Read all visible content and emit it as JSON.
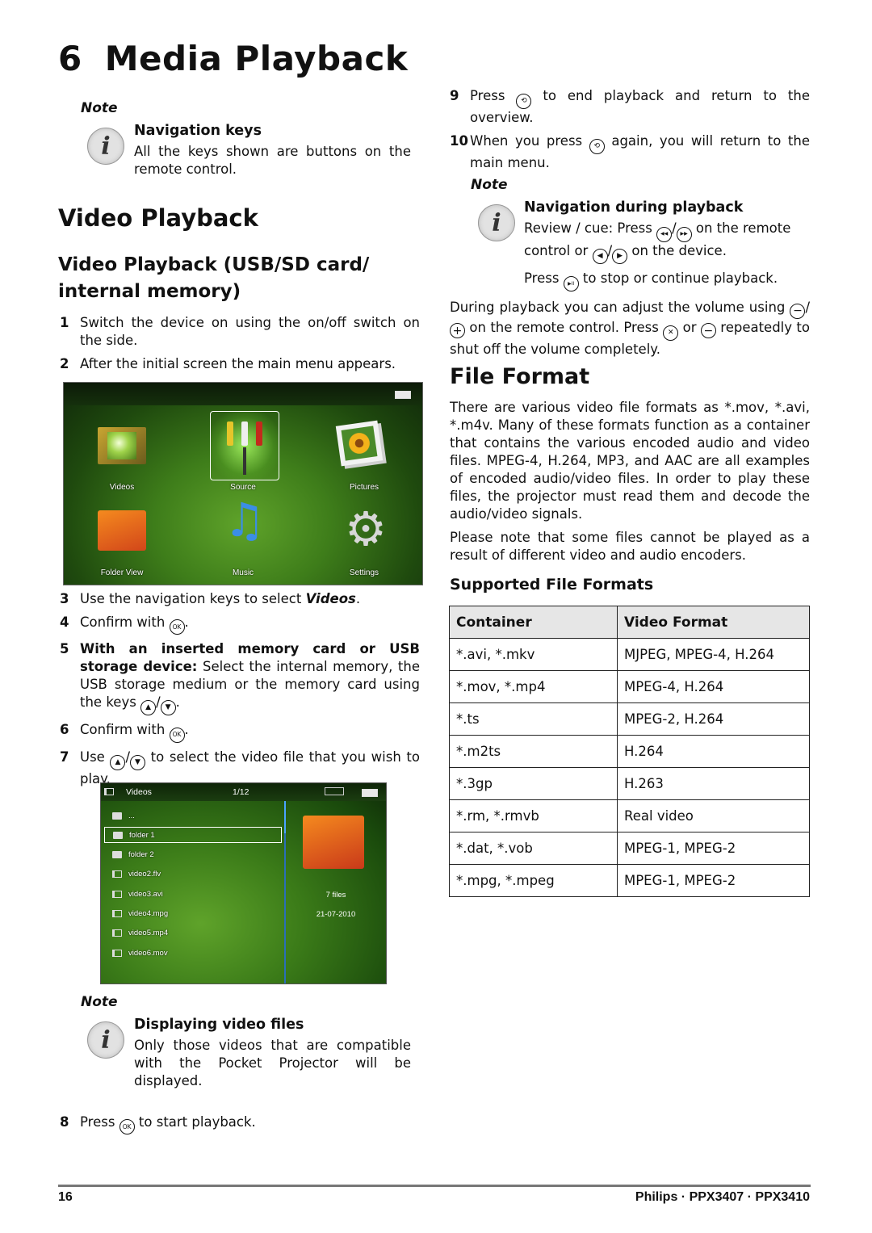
{
  "chapter": {
    "number": "6",
    "title": "Media Playback"
  },
  "note_nav_keys": {
    "label": "Note",
    "title": "Navigation keys",
    "body": "All the keys shown are buttons on the remote control."
  },
  "section_title": "Video Playback",
  "subsection_title_line1": "Video Playback (USB/SD card/",
  "subsection_title_line2": "internal memory)",
  "steps": {
    "s1": {
      "n": "1",
      "text": "Switch the device on using the on/off switch on the side."
    },
    "s2": {
      "n": "2",
      "text": "After the initial screen the main menu appears."
    },
    "s3": {
      "n": "3",
      "pre": "Use the navigation keys to select ",
      "em": "Videos",
      "post": "."
    },
    "s4": {
      "n": "4",
      "pre": "Confirm with ",
      "post": "."
    },
    "s5": {
      "n": "5",
      "bold": "With an inserted memory card or USB storage device:",
      "text": " Select the internal memory, the USB storage medium or the memory card using the keys "
    },
    "s6": {
      "n": "6",
      "pre": "Confirm with ",
      "post": "."
    },
    "s7": {
      "n": "7",
      "pre": "Use ",
      "post": " to select the video file that you wish to play."
    },
    "s8": {
      "n": "8",
      "pre": "Press ",
      "post": " to start playback."
    },
    "s9": {
      "n": "9",
      "pre": "Press ",
      "post": " to end playback and return to the overview."
    },
    "s10": {
      "n": "10",
      "pre": "When you press ",
      "post": " again, you will return to the main menu."
    }
  },
  "keys": {
    "ok": "OK",
    "up": "▲",
    "down": "▼",
    "back": "⟲",
    "rew": "◀◀",
    "ffw": "▶▶",
    "left": "◀",
    "right": "▶",
    "playpause": "▶II",
    "minus": "−",
    "plus": "+",
    "mute": "✕",
    "slash": "/"
  },
  "main_menu_screen": {
    "items": [
      "Videos",
      "Source",
      "Pictures",
      "Folder View",
      "Music",
      "Settings"
    ],
    "selected": "Source"
  },
  "file_browser_screen": {
    "title": "Videos",
    "counter": "1/12",
    "rows": [
      "...",
      "folder 1",
      "folder 2",
      "video2.flv",
      "video3.avi",
      "video4.mpg",
      "video5.mp4",
      "video6.mov"
    ],
    "selected": "folder 1",
    "preview_files": "7 files",
    "preview_date": "21-07-2010"
  },
  "note_display": {
    "label": "Note",
    "title": "Displaying video files",
    "body": "Only those videos that are compatible with the Pocket Projector will be displayed."
  },
  "note_playback": {
    "label": "Note",
    "title": "Navigation during playback",
    "line1_pre": "Review / cue: Press ",
    "line1_post": " on the remote control or ",
    "line1_end": " on the device.",
    "line2_pre": "Press ",
    "line2_post": " to stop or continue playback."
  },
  "volume_text": {
    "pre": "During playback you can adjust the volume using ",
    "mid": " on the remote control. Press ",
    "or": " or ",
    "post": " repeatedly to shut off the volume completely."
  },
  "file_format": {
    "title": "File Format",
    "para1": "There are various video file formats as *.mov, *.avi, *.m4v. Many of these formats function as a container that contains the various encoded audio and video files. MPEG-4, H.264, MP3, and AAC are all examples of encoded audio/video files. In order to play these files, the projector must read them and decode the audio/video signals.",
    "para2": "Please note that some files cannot be played as a result of different video and audio encoders.",
    "table_title": "Supported File Formats",
    "headers": [
      "Container",
      "Video Format"
    ],
    "rows": [
      [
        "*.avi, *.mkv",
        "MJPEG, MPEG-4, H.264"
      ],
      [
        "*.mov, *.mp4",
        "MPEG-4, H.264"
      ],
      [
        "*.ts",
        "MPEG-2, H.264"
      ],
      [
        "*.m2ts",
        "H.264"
      ],
      [
        "*.3gp",
        "H.263"
      ],
      [
        "*.rm, *.rmvb",
        "Real video"
      ],
      [
        "*.dat, *.vob",
        "MPEG-1, MPEG-2"
      ],
      [
        "*.mpg, *.mpeg",
        "MPEG-1, MPEG-2"
      ]
    ]
  },
  "footer": {
    "page": "16",
    "product": "Philips · PPX3407 · PPX3410"
  }
}
